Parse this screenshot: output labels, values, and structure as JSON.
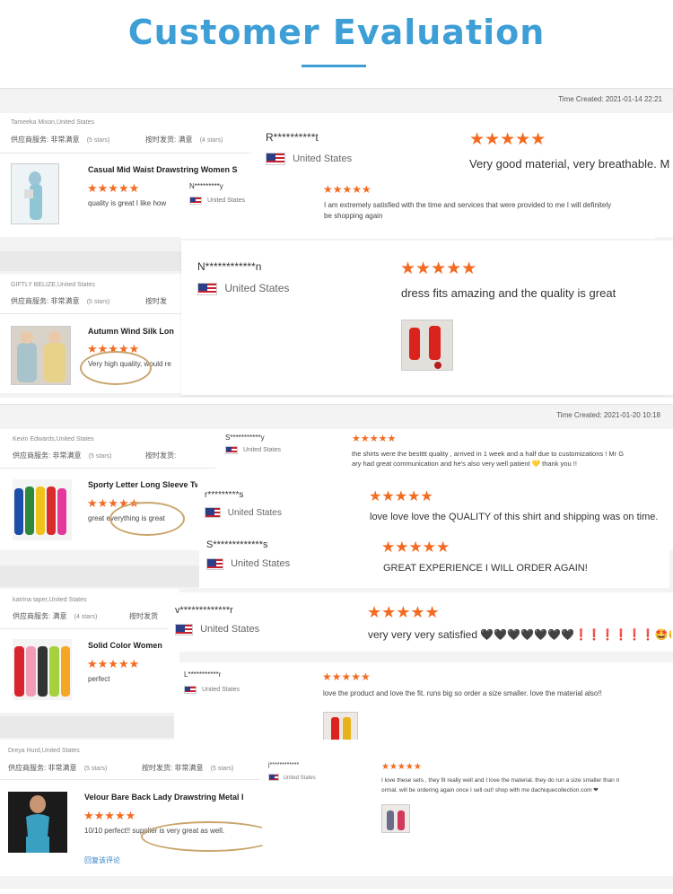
{
  "header": {
    "title": "Customer Evaluation"
  },
  "panels": [
    {
      "time": "Time Created: 2021-01-14 22:21"
    },
    {
      "time": "Time Created: 2021-01-20 10:18"
    }
  ],
  "left_reviews": [
    {
      "user": "Tameeka Mixon,United States",
      "rating_service": "供应商服务: 非常满意",
      "rating_service_stars": "(5 stars)",
      "rating_ship": "按时发货: 满意",
      "rating_ship_stars": "(4 stars)",
      "product": "Casual Mid Waist Drawstring Women S",
      "text": "quality is great I like how"
    },
    {
      "user": "GIFTLY BELIZE,United States",
      "rating_service": "供应商服务: 非常满意",
      "rating_service_stars": "(5 stars)",
      "rating_ship": "按时发",
      "product": "Autumn Wind Silk Lon",
      "text": "Very high quality, would re"
    },
    {
      "user": "Kevin Edwards,United States",
      "rating_service": "供应商服务: 非常满意",
      "rating_service_stars": "(5 stars)",
      "rating_ship": "按时发货:",
      "product": "Sporty Letter Long Sleeve Two",
      "text": "great everything is great"
    },
    {
      "user": "katrina taper,United States",
      "rating_service": "供应商服务: 满意",
      "rating_service_stars": "(4 stars)",
      "rating_ship": "按时发货",
      "product": "Solid Color Women",
      "text": "perfect"
    },
    {
      "user": "Dreya Hurd,United States",
      "rating_service": "供应商服务: 非常满意",
      "rating_service_stars": "(5 stars)",
      "rating_ship": "按时发货: 非常满意",
      "rating_ship_stars": "(5 stars)",
      "product": "Velour Bare Back Lady Drawstring Metal I",
      "text": "10/10 perfect!! supplier is very great as well.",
      "reply": "回复该评论"
    }
  ],
  "overlay_reviews": [
    {
      "user": "R**********t",
      "country": "United States",
      "text": "Very good material, very breathable. M"
    },
    {
      "user": "N*********y",
      "country": "United States",
      "text": "I am extremely satisfied with the time and services that were provided to me I will definitely",
      "text2": "be shopping again"
    },
    {
      "user": "N************n",
      "country": "United States",
      "text": "dress fits amazing and the quality is great"
    },
    {
      "user": "S***********y",
      "country": "United States",
      "text": "the shirts were the bestttt quality , arrived in 1 week and a half due to customizations ! Mr G",
      "text2": "ary had great communication and he's also very well patient 💛 thank you !!"
    },
    {
      "user": "r*********s",
      "country": "United States",
      "text": "love love love the QUALITY of this shirt and shipping was on time."
    },
    {
      "user": "S*************s",
      "country": "United States",
      "text": "GREAT EXPERIENCE I WILL ORDER AGAIN!"
    },
    {
      "user": "v*************r",
      "country": "United States",
      "text": "very very very satisfied 🖤🖤🖤🖤🖤🖤🖤❗❗❗❗❗❗🤩😋"
    },
    {
      "user": "L***********r",
      "country": "United States",
      "text": "love the product and love the fit. runs big so order a size smaller. love the material also!!"
    },
    {
      "user": "j************",
      "country": "United States",
      "text": "I love these sets , they fit really well and I love the material. they do run a size smaller than n",
      "text2": "ormal. will be ordering again once I sell out! shop with me dachiquecollection.com ❤"
    }
  ],
  "stars": "★★★★★",
  "colors": {
    "accent": "#3d9fd6",
    "star": "#f36b21",
    "oval": "#c9a46b"
  }
}
